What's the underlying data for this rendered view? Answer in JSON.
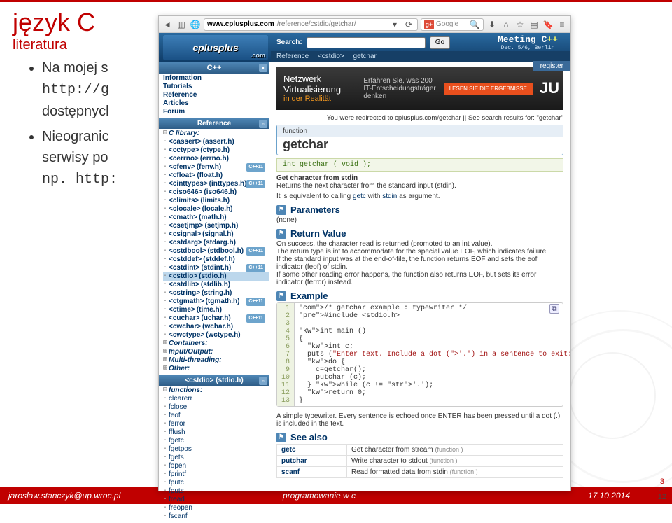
{
  "slide": {
    "title": "język C",
    "subtitle": "literatura",
    "bullets": [
      {
        "text": "Na mojej s",
        "mono": "http://g",
        "text2": "dostępnycl"
      },
      {
        "text": "Nieogranic",
        "text2": "serwisy po",
        "mono": "np. http:"
      }
    ]
  },
  "footer": {
    "left": "jaroslaw.stanczyk@up.wroc.pl",
    "center": "programowanie w c",
    "right": "17.10.2014"
  },
  "page": {
    "current": "3",
    "total": "12"
  },
  "browser": {
    "url": {
      "domain": "www.cplusplus.com",
      "path": "/reference/cstdio/getchar/"
    },
    "google_placeholder": "Google",
    "header": {
      "logo": "cplusplus",
      "dotcom": ".com",
      "search_label": "Search:",
      "go": "Go",
      "crumbs": [
        "Reference",
        "<cstdio>",
        "getchar"
      ],
      "meeting": {
        "title": "Meeting C",
        "plus": "++",
        "sub": "Dec. 5/6, Berlin"
      },
      "register": "register"
    },
    "nav_top": {
      "head": "C++",
      "items": [
        "Information",
        "Tutorials",
        "Reference",
        "Articles",
        "Forum"
      ]
    },
    "nav_ref": {
      "head": "Reference",
      "lib_label": "C library:",
      "items": [
        {
          "a": "<cassert>",
          "b": "(assert.h)",
          "cpp": false
        },
        {
          "a": "<cctype>",
          "b": "(ctype.h)",
          "cpp": false
        },
        {
          "a": "<cerrno>",
          "b": "(errno.h)",
          "cpp": false
        },
        {
          "a": "<cfenv>",
          "b": "(fenv.h)",
          "cpp": true
        },
        {
          "a": "<cfloat>",
          "b": "(float.h)",
          "cpp": false
        },
        {
          "a": "<cinttypes>",
          "b": "(inttypes.h)",
          "cpp": true
        },
        {
          "a": "<ciso646>",
          "b": "(iso646.h)",
          "cpp": false
        },
        {
          "a": "<climits>",
          "b": "(limits.h)",
          "cpp": false
        },
        {
          "a": "<clocale>",
          "b": "(locale.h)",
          "cpp": false
        },
        {
          "a": "<cmath>",
          "b": "(math.h)",
          "cpp": false
        },
        {
          "a": "<csetjmp>",
          "b": "(setjmp.h)",
          "cpp": false
        },
        {
          "a": "<csignal>",
          "b": "(signal.h)",
          "cpp": false
        },
        {
          "a": "<cstdarg>",
          "b": "(stdarg.h)",
          "cpp": false
        },
        {
          "a": "<cstdbool>",
          "b": "(stdbool.h)",
          "cpp": true
        },
        {
          "a": "<cstddef>",
          "b": "(stddef.h)",
          "cpp": false
        },
        {
          "a": "<cstdint>",
          "b": "(stdint.h)",
          "cpp": true
        },
        {
          "a": "<cstdio>",
          "b": "(stdio.h)",
          "cpp": false,
          "hl": true
        },
        {
          "a": "<cstdlib>",
          "b": "(stdlib.h)",
          "cpp": false
        },
        {
          "a": "<cstring>",
          "b": "(string.h)",
          "cpp": false
        },
        {
          "a": "<ctgmath>",
          "b": "(tgmath.h)",
          "cpp": true
        },
        {
          "a": "<ctime>",
          "b": "(time.h)",
          "cpp": false
        },
        {
          "a": "<cuchar>",
          "b": "(uchar.h)",
          "cpp": true
        },
        {
          "a": "<cwchar>",
          "b": "(wchar.h)",
          "cpp": false
        },
        {
          "a": "<cwctype>",
          "b": "(wctype.h)",
          "cpp": false
        }
      ],
      "groups": [
        "Containers:",
        "Input/Output:",
        "Multi-threading:",
        "Other:"
      ]
    },
    "nav_hdr": {
      "head": "<cstdio> (stdio.h)",
      "label": "functions:",
      "items": [
        "clearerr",
        "fclose",
        "feof",
        "ferror",
        "fflush",
        "fgetc",
        "fgetpos",
        "fgets",
        "fopen",
        "fprintf",
        "fputc",
        "fputs",
        "fread",
        "freopen",
        "fscanf"
      ]
    },
    "main": {
      "banner": {
        "a": "Netzwerk",
        "b": "Virtualisierung",
        "c": "in der Realität",
        "mid1": "Erfahren Sie, was 200",
        "mid2": "IT-Entscheidungsträger",
        "mid3": "denken",
        "btn": "LESEN SIE DIE ERGEBNISSE",
        "ju": "JU"
      },
      "redir": "You were redirected to cplusplus.com/getchar || See search results for: \"getchar\"",
      "func_label": "function",
      "func_name": "getchar",
      "signature": "int getchar ( void );",
      "desc_title": "Get character from stdin",
      "desc1": "Returns the next character from the standard input (stdin).",
      "desc2_pre": "It is equivalent to calling ",
      "desc2_link1": "getc",
      "desc2_mid": " with ",
      "desc2_link2": "stdin",
      "desc2_post": " as argument.",
      "sec_params": "Parameters",
      "params_body": "(none)",
      "sec_return": "Return Value",
      "ret1": "On success, the character read is returned (promoted to an int value).",
      "ret2": "The return type is int to accommodate for the special value EOF, which indicates failure:",
      "ret3": "If the standard input was at the end-of-file, the function returns EOF and sets the eof indicator (feof) of stdin.",
      "ret4": "If some other reading error happens, the function also returns EOF, but sets its error indicator (ferror) instead.",
      "sec_example": "Example",
      "code": [
        "/* getchar example : typewriter */",
        "#include <stdio.h>",
        "",
        "int main ()",
        "{",
        "  int c;",
        "  puts (\"Enter text. Include a dot ('.') in a sentence to exit:\");",
        "  do {",
        "    c=getchar();",
        "    putchar (c);",
        "  } while (c != '.');",
        "  return 0;",
        "}"
      ],
      "example_note": "A simple typewriter. Every sentence is echoed once ENTER has been pressed until a dot (.) is included in the text.",
      "sec_seealso": "See also",
      "seealso": [
        {
          "name": "getc",
          "desc": "Get character from stream",
          "type": "(function )"
        },
        {
          "name": "putchar",
          "desc": "Write character to stdout",
          "type": "(function )"
        },
        {
          "name": "scanf",
          "desc": "Read formatted data from stdin",
          "type": "(function )"
        }
      ]
    }
  }
}
